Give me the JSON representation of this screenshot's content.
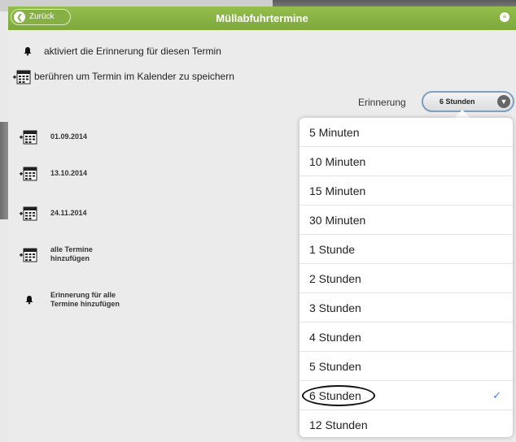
{
  "navbar": {
    "back_label": "Zurück",
    "title": "Müllabfuhrtermine"
  },
  "info": {
    "bell_text": "aktiviert die Erinnerung für diesen Termin",
    "calendar_text": "berühren um Termin im Kalender zu speichern"
  },
  "reminder": {
    "label": "Erinnerung",
    "selected": "6 Stunden"
  },
  "dates": [
    {
      "text": "01.09.2014"
    },
    {
      "text": "13.10.2014"
    },
    {
      "text": "24.11.2014"
    }
  ],
  "actions": {
    "add_all_line1": "alle Termine",
    "add_all_line2": "hinzufügen",
    "remind_all_line1": "Erinnerung für alle",
    "remind_all_line2": "Termine hinzufügen"
  },
  "options": [
    "5 Minuten",
    "10 Minuten",
    "15 Minuten",
    "30 Minuten",
    "1 Stunde",
    "2 Stunden",
    "3 Stunden",
    "4 Stunden",
    "5 Stunden",
    "6 Stunden",
    "12 Stunden"
  ],
  "selected_index": 9,
  "colors": {
    "navbar": "#86b044",
    "check": "#3b82f6"
  }
}
